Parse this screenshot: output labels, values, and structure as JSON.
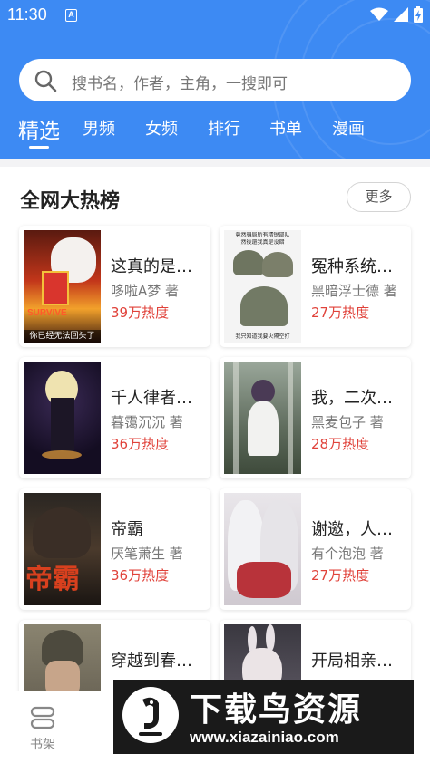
{
  "status_bar": {
    "time": "11:30",
    "notification_glyph": "A",
    "icons": [
      "wifi-icon",
      "signal-icon",
      "battery-charging-icon"
    ]
  },
  "search": {
    "placeholder": "搜书名，作者，主角，一搜即可"
  },
  "tabs": [
    {
      "label": "精选",
      "active": true
    },
    {
      "label": "男频",
      "active": false
    },
    {
      "label": "女频",
      "active": false
    },
    {
      "label": "排行",
      "active": false
    },
    {
      "label": "书单",
      "active": false
    },
    {
      "label": "漫画",
      "active": false
    }
  ],
  "section": {
    "title": "全网大热榜",
    "more_label": "更多"
  },
  "books": [
    {
      "title": "这真的是特…",
      "author": "哆啦A梦 著",
      "heat": "39万热度",
      "cover_text": [
        "SURVIVE",
        "你已经无法回头了"
      ]
    },
    {
      "title": "冤种系统和…",
      "author": "黑暗浮士德 著",
      "heat": "27万热度",
      "cover_text": [
        "竟然骗局所有精锐部队",
        "然後還我真是没錯",
        "我只知道我要火隔空打"
      ]
    },
    {
      "title": "千人律者的…",
      "author": "暮霭沉沉 著",
      "heat": "36万热度",
      "cover_text": []
    },
    {
      "title": "我，二次元…",
      "author": "黑麦包子 著",
      "heat": "28万热度",
      "cover_text": []
    },
    {
      "title": "帝霸",
      "author": "厌笔萧生 著",
      "heat": "36万热度",
      "cover_text": [
        "帝霸"
      ]
    },
    {
      "title": "谢邀，人在…",
      "author": "有个泡泡 著",
      "heat": "27万热度",
      "cover_text": []
    },
    {
      "title": "穿越到春物…",
      "author": "",
      "heat": "",
      "cover_text": []
    },
    {
      "title": "开局相亲，…",
      "author": "",
      "heat": "",
      "cover_text": []
    }
  ],
  "bottom_nav": {
    "bookshelf_label": "书架"
  },
  "watermark": {
    "text": "下载鸟资源",
    "url": "www.xiazainiao.com"
  },
  "colors": {
    "brand_blue": "#3d8af3",
    "heat_red": "#e0423a"
  }
}
